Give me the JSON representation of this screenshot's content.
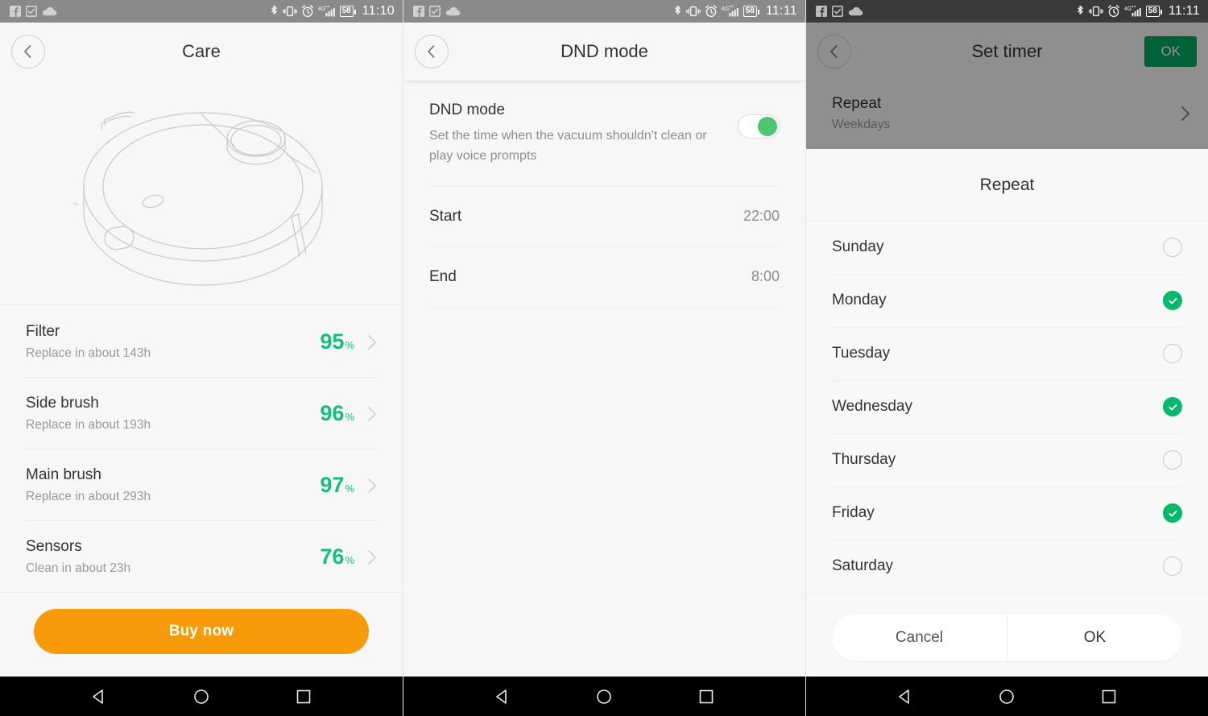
{
  "statusbar": {
    "icons_left": [
      "facebook-icon",
      "tasks-icon",
      "cloud-icon"
    ],
    "icons_right": [
      "bluetooth-icon",
      "vibrate-icon",
      "alarm-icon",
      "signal-4g-icon"
    ],
    "battery_level": "58",
    "time_left": "11:10",
    "time_middle": "11:11",
    "time_right": "11:11"
  },
  "care": {
    "title": "Care",
    "illustration": "robot-vacuum-line-drawing",
    "items": [
      {
        "name": "Filter",
        "sub": "Replace in about 143h",
        "value": "95",
        "unit": "%"
      },
      {
        "name": "Side brush",
        "sub": "Replace in about 193h",
        "value": "96",
        "unit": "%"
      },
      {
        "name": "Main brush",
        "sub": "Replace in about 293h",
        "value": "97",
        "unit": "%"
      },
      {
        "name": "Sensors",
        "sub": "Clean in about 23h",
        "value": "76",
        "unit": "%"
      }
    ],
    "buy_label": "Buy now"
  },
  "dnd": {
    "title": "DND mode",
    "section_title": "DND mode",
    "description": "Set the time when the vacuum shouldn't clean or play voice prompts",
    "enabled": true,
    "rows": [
      {
        "label": "Start",
        "value": "22:00"
      },
      {
        "label": "End",
        "value": "8:00"
      }
    ]
  },
  "timer": {
    "title": "Set timer",
    "ok_label": "OK",
    "repeat_row": {
      "label": "Repeat",
      "value": "Weekdays"
    },
    "dialog": {
      "title": "Repeat",
      "days": [
        {
          "label": "Sunday",
          "checked": false
        },
        {
          "label": "Monday",
          "checked": true
        },
        {
          "label": "Tuesday",
          "checked": false
        },
        {
          "label": "Wednesday",
          "checked": true
        },
        {
          "label": "Thursday",
          "checked": false
        },
        {
          "label": "Friday",
          "checked": true
        },
        {
          "label": "Saturday",
          "checked": false
        }
      ],
      "cancel_label": "Cancel",
      "ok_label": "OK"
    }
  },
  "navbar": {
    "back": "back-triangle-icon",
    "home": "home-circle-icon",
    "recents": "recents-square-icon"
  },
  "colors": {
    "accent_green": "#16c07a",
    "check_green": "#00b96b",
    "ok_green": "#00a862",
    "buy_orange": "#f79b0b",
    "panel_bg": "#f7f7f7"
  }
}
